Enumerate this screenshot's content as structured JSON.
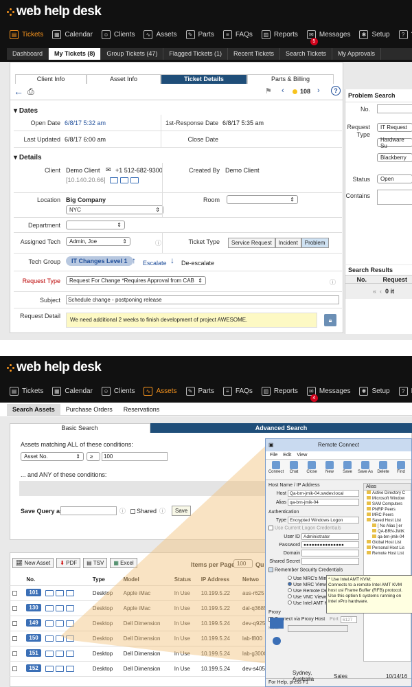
{
  "top": {
    "logo": "web help desk",
    "nav": [
      {
        "label": "Tickets",
        "icon": "tickets-icon",
        "active": true
      },
      {
        "label": "Calendar",
        "icon": "calendar-icon"
      },
      {
        "label": "Clients",
        "icon": "clients-icon"
      },
      {
        "label": "Assets",
        "icon": "assets-icon"
      },
      {
        "label": "Parts",
        "icon": "parts-icon"
      },
      {
        "label": "FAQs",
        "icon": "faqs-icon"
      },
      {
        "label": "Reports",
        "icon": "reports-icon"
      },
      {
        "label": "Messages",
        "icon": "messages-icon",
        "badge": "5"
      },
      {
        "label": "Setup",
        "icon": "setup-icon"
      },
      {
        "label": "?",
        "icon": "help-icon"
      }
    ],
    "subnav": [
      "Dashboard",
      "My Tickets (8)",
      "Group Tickets (47)",
      "Flagged Tickets (1)",
      "Recent Tickets",
      "Search Tickets",
      "My Approvals"
    ],
    "tabs": [
      "Client Info",
      "Asset Info",
      "Ticket Details",
      "Parts & Billing"
    ],
    "ticket_number": "108",
    "dates": {
      "section": "Dates",
      "open_label": "Open Date",
      "open_value": "6/8/17 5:32 am",
      "first_label": "1st-Response Date",
      "first_value": "6/8/17 5:35 am",
      "updated_label": "Last Updated",
      "updated_value": "6/8/17 6:00 am",
      "close_label": "Close Date"
    },
    "details": {
      "section": "Details",
      "client_label": "Client",
      "client_name": "Demo Client",
      "client_phone": "+1 512-682-9300",
      "client_ip": "[10.140.20.66]",
      "created_label": "Created By",
      "created_value": "Demo Client",
      "location_label": "Location",
      "location_name": "Big Company",
      "location_select": "NYC",
      "room_label": "Room",
      "department_label": "Department",
      "tech_label": "Assigned Tech",
      "tech_select": "Admin, Joe",
      "type_label": "Ticket Type",
      "types": [
        "Service Request",
        "Incident",
        "Problem"
      ],
      "group_label": "Tech Group",
      "group_value": "IT Changes  Level 1",
      "escalate": "Escalate",
      "deescalate": "De-escalate",
      "reqtype_label": "Request Type",
      "reqtype_select": "Request For Change *Requires Approval from CAB",
      "subject_label": "Subject",
      "subject_value": "Schedule change - postponing release",
      "detail_label": "Request Detail",
      "detail_value": "We need additional 2 weeks to finish development of project AWESOME."
    },
    "search": {
      "title": "Problem Search",
      "no_label": "No.",
      "reqtype_label": "Request Type",
      "reqtype_opts": [
        "IT Request",
        "Hardware Su",
        "Blackberry"
      ],
      "status_label": "Status",
      "status_value": "Open",
      "contains_label": "Contains",
      "results_title": "Search Results",
      "col_no": "No.",
      "col_req": "Request",
      "pager": "0 it"
    }
  },
  "bottom": {
    "logo": "web help desk",
    "nav": [
      {
        "label": "Tickets",
        "icon": "tickets-icon"
      },
      {
        "label": "Calendar",
        "icon": "calendar-icon"
      },
      {
        "label": "Clients",
        "icon": "clients-icon"
      },
      {
        "label": "Assets",
        "icon": "assets-icon",
        "active": true
      },
      {
        "label": "Parts",
        "icon": "parts-icon"
      },
      {
        "label": "FAQs",
        "icon": "faqs-icon"
      },
      {
        "label": "Reports",
        "icon": "reports-icon"
      },
      {
        "label": "Messages",
        "icon": "messages-icon",
        "badge": "4"
      },
      {
        "label": "Setup",
        "icon": "setup-icon"
      },
      {
        "label": "Help",
        "icon": "help-icon"
      }
    ],
    "subnav": [
      "Search Assets",
      "Purchase Orders",
      "Reservations"
    ],
    "tabs": [
      "Basic Search",
      "Advanced Search"
    ],
    "match_all": "Assets matching ALL of these conditions:",
    "cond_field": "Asset No.",
    "cond_op": "≥",
    "cond_value": "100",
    "match_any": "... and ANY of these conditions:",
    "save_label": "Save Query as",
    "shared": "Shared",
    "save_btn": "Save",
    "toolbar": [
      "New Asset",
      "PDF",
      "TSV",
      "Excel"
    ],
    "items_label": "Items per Page",
    "items_value": "100",
    "qu": "Qu",
    "columns": [
      "No.",
      "Type",
      "Model",
      "Status",
      "IP Address",
      "Netwo"
    ],
    "rows": [
      {
        "id": "101",
        "type": "Desktop",
        "model": "Apple iMac",
        "status": "In Use",
        "ip": "10.199.5.22",
        "net": "aus-r625"
      },
      {
        "id": "130",
        "type": "Desktop",
        "model": "Apple iMac",
        "status": "In Use",
        "ip": "10.199.5.22",
        "net": "dal-q3685"
      },
      {
        "id": "149",
        "type": "Desktop",
        "model": "Dell Dimension",
        "status": "In Use",
        "ip": "10.199.5.24",
        "net": "dev-q9257"
      },
      {
        "id": "150",
        "type": "Desktop",
        "model": "Dell Dimension",
        "status": "In Use",
        "ip": "10.199.5.24",
        "net": "lab-f800"
      },
      {
        "id": "151",
        "type": "Desktop",
        "model": "Dell Dimension",
        "status": "In Use",
        "ip": "10.199.5.24",
        "net": "lab-g300C"
      },
      {
        "id": "152",
        "type": "Desktop",
        "model": "Dell Dimension",
        "status": "In Use",
        "ip": "10.199.5.24",
        "net": "dev-s405",
        "extra1": "Sydney, Australia",
        "extra2": "Sales",
        "extra3": "10/14/16"
      }
    ],
    "remote": {
      "title": "Remote Connect",
      "menu": [
        "File",
        "Edit",
        "View"
      ],
      "tools": [
        "Connect",
        "Chat",
        "Close",
        "New",
        "Save",
        "Save As",
        "Delete",
        "Find"
      ],
      "host_section": "Host Name / IP Address",
      "host_label": "Host",
      "host_value": "Qa-brn-jmik-04.swdev.local",
      "alias_label": "Alias",
      "alias_value": "qa-brn-jmik-04",
      "auth_section": "Authentication",
      "type_label": "Type",
      "type_value": "Encrypted Windows Logon",
      "use_current": "Use Current Logon Credentials",
      "uid_label": "User ID",
      "uid_value": "Administrator",
      "pwd_label": "Password",
      "pwd_value": "●●●●●●●●●●●●●●●",
      "domain_label": "Domain",
      "shared_label": "Shared Secret",
      "remember": "Remember Security Credentials",
      "viewer_opts": [
        "Use MRC's Mirror",
        "Use MRC Viewer",
        "Use Remote De",
        "Use VNC Viewer (Linux or MAC)",
        "Use Intel AMT KVM"
      ],
      "tooltip_title": "* Use Intel AMT KVM:",
      "tooltip_body": "Connects to a remote Intel AMT KVM host usi Frame Buffer (RFB) protocol. Use this option ti systems running on Intel vPro hardware.",
      "proxy_section": "Proxy",
      "proxy_chk": "Connect via Proxy Host",
      "port_label": "Port",
      "port_value": "6127",
      "proxy_host": "Host",
      "alias_header": "Alias",
      "tree": [
        "Active Directory C",
        "Microsoft Window",
        "SAM Computers",
        "PNRP Peers",
        "MRC Peers",
        "Saved Host List",
        "[ No Alias ] er",
        "QA-BRN-JMIK",
        "qa-brn-jmik-04",
        "Global Host List",
        "Personal Host Lis",
        "Remote Host List"
      ],
      "status": "For Help, press F1"
    }
  },
  "colors": {
    "accent": "#f7941d",
    "navy": "#1f4e79",
    "blue": "#3b6fb6",
    "badge": "#d0021b"
  }
}
